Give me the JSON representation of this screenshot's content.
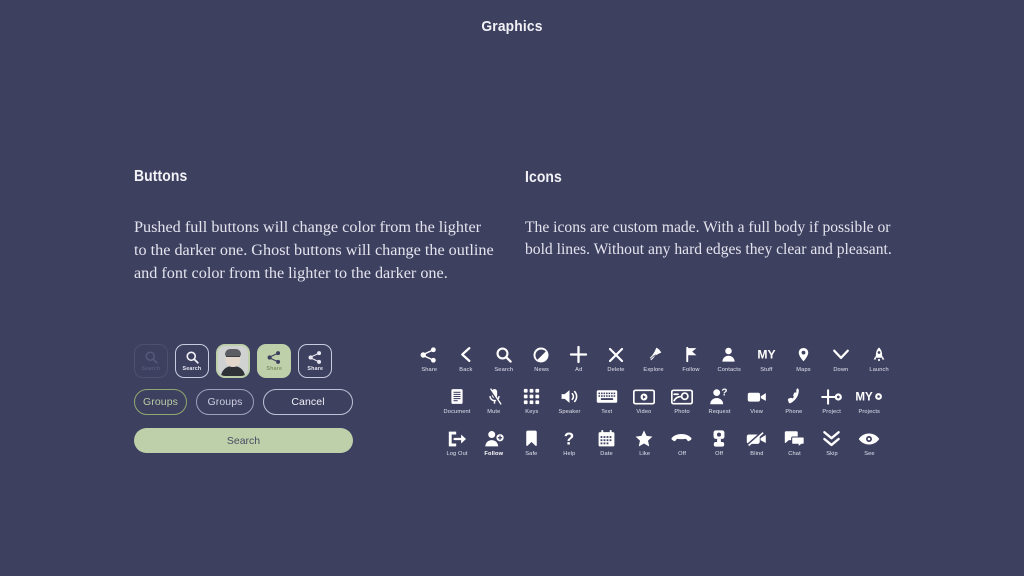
{
  "page": {
    "title": "Graphics",
    "background": "#3e4060",
    "accent_green": "#bdd0aa",
    "text_color": "#f2f2f7"
  },
  "sections": {
    "buttons": {
      "heading": "Buttons",
      "body": "Pushed full buttons will change color from the lighter to the darker one. Ghost buttons will change the outline and font color from the lighter to the darker one."
    },
    "icons": {
      "heading": "Icons",
      "body": "The icons are custom made. With a full body if possible or bold lines. Without any hard edges they clear and pleasant."
    }
  },
  "button_samples": {
    "icon_buttons": [
      {
        "label": "Search",
        "icon": "search-icon",
        "style": "ghost-dim"
      },
      {
        "label": "Search",
        "icon": "search-icon",
        "style": "ghost-bright"
      },
      {
        "label": "",
        "icon": "avatar-icon",
        "style": "avatar"
      },
      {
        "label": "Share",
        "icon": "share-icon",
        "style": "filled"
      },
      {
        "label": "Share",
        "icon": "share-icon",
        "style": "ghost-bright"
      }
    ],
    "pill_buttons": [
      {
        "label": "Groups",
        "style": "ghost-green"
      },
      {
        "label": "Groups",
        "style": "ghost-gray"
      },
      {
        "label": "Cancel",
        "style": "ghost-light"
      }
    ],
    "full_button": {
      "label": "Search",
      "style": "filled-green"
    }
  },
  "icon_grid": {
    "rows": [
      [
        {
          "label": "Share",
          "icon": "share-icon"
        },
        {
          "label": "Back",
          "icon": "chevron-left-icon"
        },
        {
          "label": "Search",
          "icon": "search-icon"
        },
        {
          "label": "News",
          "icon": "news-icon"
        },
        {
          "label": "Ad",
          "icon": "plus-icon"
        },
        {
          "label": "Delete",
          "icon": "close-x-icon"
        },
        {
          "label": "Explore",
          "icon": "compass-needle-icon"
        },
        {
          "label": "Follow",
          "icon": "flag-icon"
        },
        {
          "label": "Contacts",
          "icon": "person-icon"
        },
        {
          "label": "Stuff",
          "icon": "my-text-icon"
        },
        {
          "label": "Maps",
          "icon": "map-pin-icon"
        },
        {
          "label": "Down",
          "icon": "chevron-down-icon"
        },
        {
          "label": "Launch",
          "icon": "rocket-icon"
        }
      ],
      [
        {
          "label": "Document",
          "icon": "document-icon"
        },
        {
          "label": "Mute",
          "icon": "mic-muted-icon"
        },
        {
          "label": "Keys",
          "icon": "keypad-grid-icon"
        },
        {
          "label": "Speaker",
          "icon": "speaker-icon"
        },
        {
          "label": "Text",
          "icon": "keyboard-icon"
        },
        {
          "label": "Video",
          "icon": "video-play-icon"
        },
        {
          "label": "Photo",
          "icon": "photo-icon"
        },
        {
          "label": "Request",
          "icon": "person-question-icon"
        },
        {
          "label": "View",
          "icon": "camcorder-icon"
        },
        {
          "label": "Phone",
          "icon": "phone-icon"
        },
        {
          "label": "Project",
          "icon": "project-plus-icon"
        },
        {
          "label": "Projects",
          "icon": "my-projects-icon"
        }
      ],
      [
        {
          "label": "Log Out",
          "icon": "logout-icon",
          "emphasis": false
        },
        {
          "label": "Follow",
          "icon": "person-add-icon",
          "emphasis": true
        },
        {
          "label": "Safe",
          "icon": "bookmark-icon",
          "emphasis": false
        },
        {
          "label": "Help",
          "icon": "question-icon",
          "emphasis": false
        },
        {
          "label": "Date",
          "icon": "calendar-icon",
          "emphasis": false
        },
        {
          "label": "Like",
          "icon": "star-icon",
          "emphasis": false
        },
        {
          "label": "Off",
          "icon": "phone-hangup-icon",
          "emphasis": false
        },
        {
          "label": "Off",
          "icon": "lamp-icon",
          "emphasis": false
        },
        {
          "label": "Blind",
          "icon": "video-off-icon",
          "emphasis": false
        },
        {
          "label": "Chat",
          "icon": "chat-bubbles-icon",
          "emphasis": false
        },
        {
          "label": "Skip",
          "icon": "double-chevron-down-icon",
          "emphasis": false
        },
        {
          "label": "See",
          "icon": "eye-icon",
          "emphasis": false
        }
      ]
    ]
  }
}
